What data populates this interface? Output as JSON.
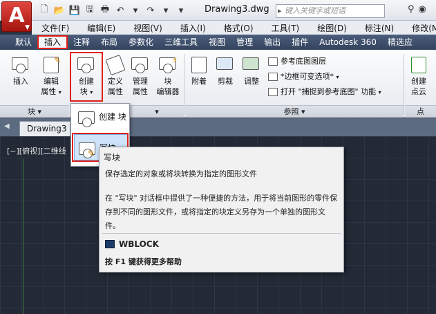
{
  "titlebar": {
    "app_letter": "A",
    "doc_title": "Drawing3.dwg",
    "search_placeholder": "键入关键字或短语"
  },
  "menubar": [
    "文件(F)",
    "编辑(E)",
    "视图(V)",
    "插入(I)",
    "格式(O)",
    "工具(T)",
    "绘图(D)",
    "标注(N)",
    "修改(M)"
  ],
  "ribbon_tabs": [
    "默认",
    "插入",
    "注释",
    "布局",
    "参数化",
    "三维工具",
    "视图",
    "管理",
    "输出",
    "插件",
    "Autodesk 360",
    "精选应"
  ],
  "ribbon": {
    "insert": [
      "插入"
    ],
    "edit_attr": [
      "编辑",
      "属性"
    ],
    "create_block": [
      "创建",
      "块"
    ],
    "define_attr": [
      "定义",
      "属性"
    ],
    "manage_attr": [
      "管理",
      "属性"
    ],
    "block_editor": [
      "块",
      "编辑器"
    ],
    "attach": "附着",
    "clip": "剪裁",
    "adjust": "调整",
    "ref_underlay_layers": "参考底图图层",
    "frame_var": "*边框可变选项*",
    "snap_underlay": "打开 \"捕捉到参考底图\" 功能",
    "create_point_cloud": [
      "创建",
      "点云"
    ],
    "panel_block": "块",
    "panel_reference": "参照"
  },
  "doc_tab": "Drawing3",
  "viewport_label": "[−][俯视][二维线",
  "dropdown": {
    "create_block": "创建 块",
    "write_block": "写块"
  },
  "tooltip": {
    "title": "写块",
    "desc": "保存选定的对象或将块转换为指定的图形文件",
    "body": "在 \"写块\" 对话框中提供了一种便捷的方法，用于将当前图形的零件保存到不同的图形文件，或将指定的块定义另存为一个单独的图形文件。",
    "command": "WBLOCK",
    "help": "按 F1 键获得更多帮助"
  },
  "colors": {
    "highlight": "#e0201b",
    "canvas": "#232a36",
    "ribbon_tab_bg": "#3b4a65"
  }
}
